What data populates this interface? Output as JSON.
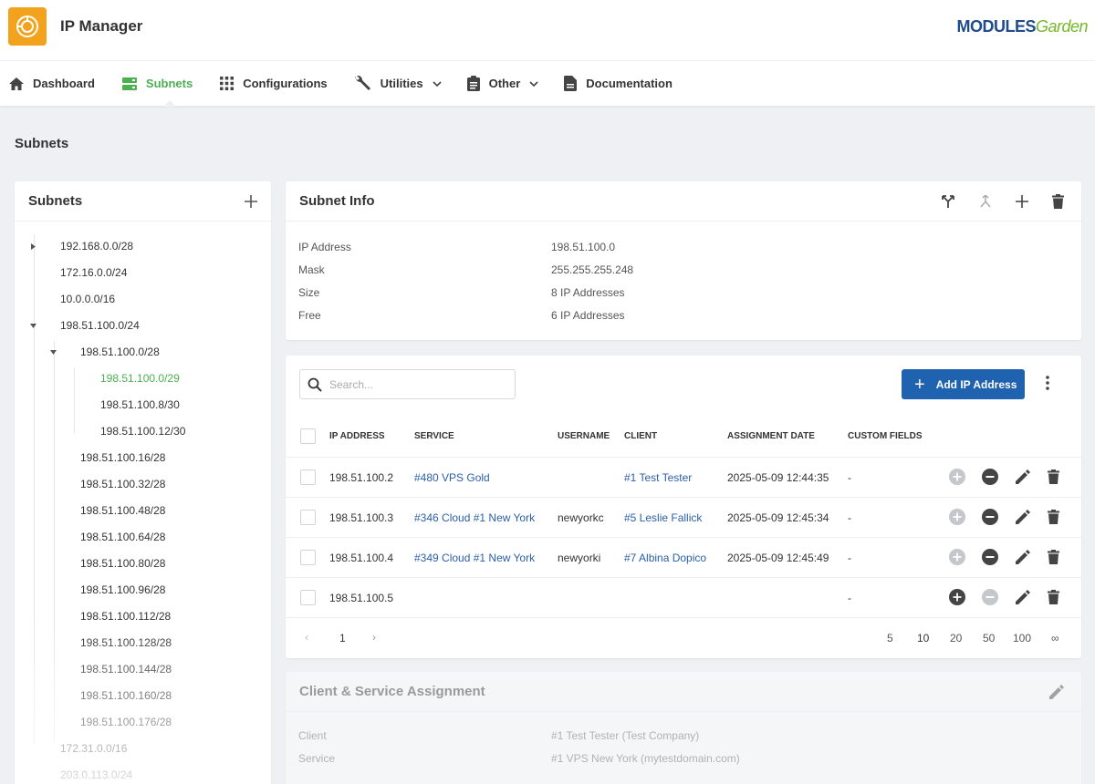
{
  "app": {
    "title": "IP Manager",
    "brand_main": "MODULES",
    "brand_accent": "Garden"
  },
  "nav": [
    {
      "label": "Dashboard",
      "icon": "home-icon"
    },
    {
      "label": "Subnets",
      "icon": "server-icon",
      "active": true
    },
    {
      "label": "Configurations",
      "icon": "grid-icon"
    },
    {
      "label": "Utilities",
      "icon": "wrench-icon",
      "dropdown": true
    },
    {
      "label": "Other",
      "icon": "clipboard-icon",
      "dropdown": true
    },
    {
      "label": "Documentation",
      "icon": "document-icon"
    }
  ],
  "page": {
    "title": "Subnets"
  },
  "tree": {
    "title": "Subnets",
    "items": [
      {
        "label": "192.168.0.0/28",
        "state": "collapsed"
      },
      {
        "label": "172.16.0.0/24"
      },
      {
        "label": "10.0.0.0/16"
      },
      {
        "label": "198.51.100.0/24",
        "state": "expanded"
      },
      {
        "label": "198.51.100.0/28",
        "state": "expanded"
      },
      {
        "label": "198.51.100.0/29",
        "selected": true
      },
      {
        "label": "198.51.100.8/30"
      },
      {
        "label": "198.51.100.12/30"
      },
      {
        "label": "198.51.100.16/28"
      },
      {
        "label": "198.51.100.32/28"
      },
      {
        "label": "198.51.100.48/28"
      },
      {
        "label": "198.51.100.64/28"
      },
      {
        "label": "198.51.100.80/28"
      },
      {
        "label": "198.51.100.96/28"
      },
      {
        "label": "198.51.100.112/28"
      },
      {
        "label": "198.51.100.128/28"
      },
      {
        "label": "198.51.100.144/28"
      },
      {
        "label": "198.51.100.160/28"
      },
      {
        "label": "198.51.100.176/28"
      },
      {
        "label": "172.31.0.0/16"
      },
      {
        "label": "203.0.113.0/24"
      }
    ]
  },
  "subnet_info": {
    "title": "Subnet Info",
    "rows": [
      {
        "label": "IP Address",
        "value": "198.51.100.0"
      },
      {
        "label": "Mask",
        "value": "255.255.255.248"
      },
      {
        "label": "Size",
        "value": "8 IP Addresses"
      },
      {
        "label": "Free",
        "value": "6 IP Addresses"
      }
    ]
  },
  "ip_table": {
    "search_placeholder": "Search...",
    "add_label": "Add IP Address",
    "columns": [
      "IP ADDRESS",
      "SERVICE",
      "USERNAME",
      "CLIENT",
      "ASSIGNMENT DATE",
      "CUSTOM FIELDS"
    ],
    "rows": [
      {
        "ip": "198.51.100.2",
        "service": "#480 VPS Gold",
        "username": "",
        "client": "#1 Test Tester",
        "date": "2025-05-09 12:44:35",
        "custom": "-"
      },
      {
        "ip": "198.51.100.3",
        "service": "#346 Cloud #1 New York",
        "username": "newyorkc",
        "client": "#5 Leslie Fallick",
        "date": "2025-05-09 12:45:34",
        "custom": "-"
      },
      {
        "ip": "198.51.100.4",
        "service": "#349 Cloud #1 New York",
        "username": "newyorki",
        "client": "#7 Albina Dopico",
        "date": "2025-05-09 12:45:49",
        "custom": "-"
      },
      {
        "ip": "198.51.100.5",
        "service": "",
        "username": "",
        "client": "",
        "date": "",
        "custom": "-"
      }
    ],
    "pagination": {
      "prev": "‹",
      "current": "1",
      "next": "›",
      "sizes": [
        "5",
        "10",
        "20",
        "50",
        "100",
        "∞"
      ],
      "active_size": "10"
    }
  },
  "assignment": {
    "title": "Client & Service Assignment",
    "rows": [
      {
        "label": "Client",
        "value": "#1 Test Tester (Test Company)"
      },
      {
        "label": "Service",
        "value": "#1 VPS New York (mytestdomain.com)"
      }
    ]
  },
  "colors": {
    "accent_green": "#4caf50",
    "primary_blue": "#1f62b0",
    "logo_orange": "#f3a21d",
    "link_blue": "#2a5fa8"
  }
}
